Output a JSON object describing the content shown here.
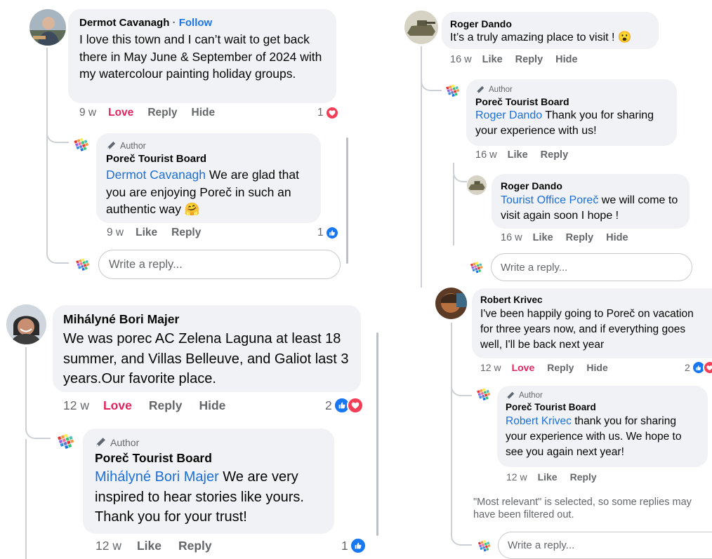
{
  "panels": {
    "dermot": {
      "comment": {
        "author": "Dermot Cavanagh",
        "separator": " · ",
        "follow": "Follow",
        "text": "I love this town and I can’t wait to get back there in May June & September of 2024 with my watercolour painting holiday groups.",
        "time": "9 w",
        "love": "Love",
        "reply": "Reply",
        "hide": "Hide",
        "reaction_count": "1"
      },
      "reply": {
        "author_tag": "Author",
        "author": "Poreč Tourist Board",
        "mention": "Dermot Cavanagh",
        "text": " We are glad that you are enjoying Poreč in such an authentic way ",
        "emoji": "🤗",
        "time": "9 w",
        "like": "Like",
        "reply": "Reply",
        "reaction_count": "1"
      },
      "input_placeholder": "Write a reply..."
    },
    "bori": {
      "comment": {
        "author": "Mihályné Bori Majer",
        "text": "We was porec AC Zelena Laguna at least 18 summer, and Villas Belleuve, and Galiot last 3 years.Our favorite place.",
        "time": "12 w",
        "love": "Love",
        "reply": "Reply",
        "hide": "Hide",
        "reaction_count": "2"
      },
      "reply": {
        "author_tag": "Author",
        "author": "Poreč Tourist Board",
        "mention": "Mihályné Bori Majer",
        "text": "  We are very inspired to hear stories like yours. Thank you for your trust!",
        "time": "12 w",
        "like": "Like",
        "reply": "Reply",
        "reaction_count": "1"
      }
    },
    "roger": {
      "comment": {
        "author": "Roger Dando",
        "text": "It’s a truly amazing place to visit ! ",
        "emoji": "😮",
        "time": "16 w",
        "like": "Like",
        "reply": "Reply",
        "hide": "Hide"
      },
      "reply1": {
        "author_tag": "Author",
        "author": "Poreč Tourist Board",
        "mention": "Roger Dando",
        "text": " Thank you for sharing your experience with us!",
        "time": "16 w",
        "like": "Like",
        "reply": "Reply"
      },
      "reply2": {
        "author": "Roger Dando",
        "mention": "Tourist Office Poreč",
        "text": " we will come to visit again soon I hope !",
        "time": "16 w",
        "like": "Like",
        "reply": "Reply",
        "hide": "Hide"
      },
      "input_placeholder": "Write a reply..."
    },
    "robert": {
      "comment": {
        "author": "Robert Krivec",
        "text": "I've been happily going to Poreč on vacation for three years now, and if everything goes well, I'll be back next year",
        "time": "12 w",
        "love": "Love",
        "reply": "Reply",
        "hide": "Hide",
        "reaction_count": "2"
      },
      "reply": {
        "author_tag": "Author",
        "author": "Poreč Tourist Board",
        "mention": "Robert Krivec",
        "text": " thank you for sharing your experience with us. We hope to see you again next year!",
        "time": "12 w",
        "like": "Like",
        "reply": "Reply"
      },
      "notice": "\"Most relevant\" is selected, so some replies may have been filtered out.",
      "input_placeholder": "Write a reply..."
    }
  },
  "colors": {
    "bubble": "#f0f2f5",
    "link": "#1b74e4",
    "love": "#e0245e",
    "like_icon": "#1877f2",
    "heart_icon": "#f33e58",
    "meta": "#65676b"
  }
}
